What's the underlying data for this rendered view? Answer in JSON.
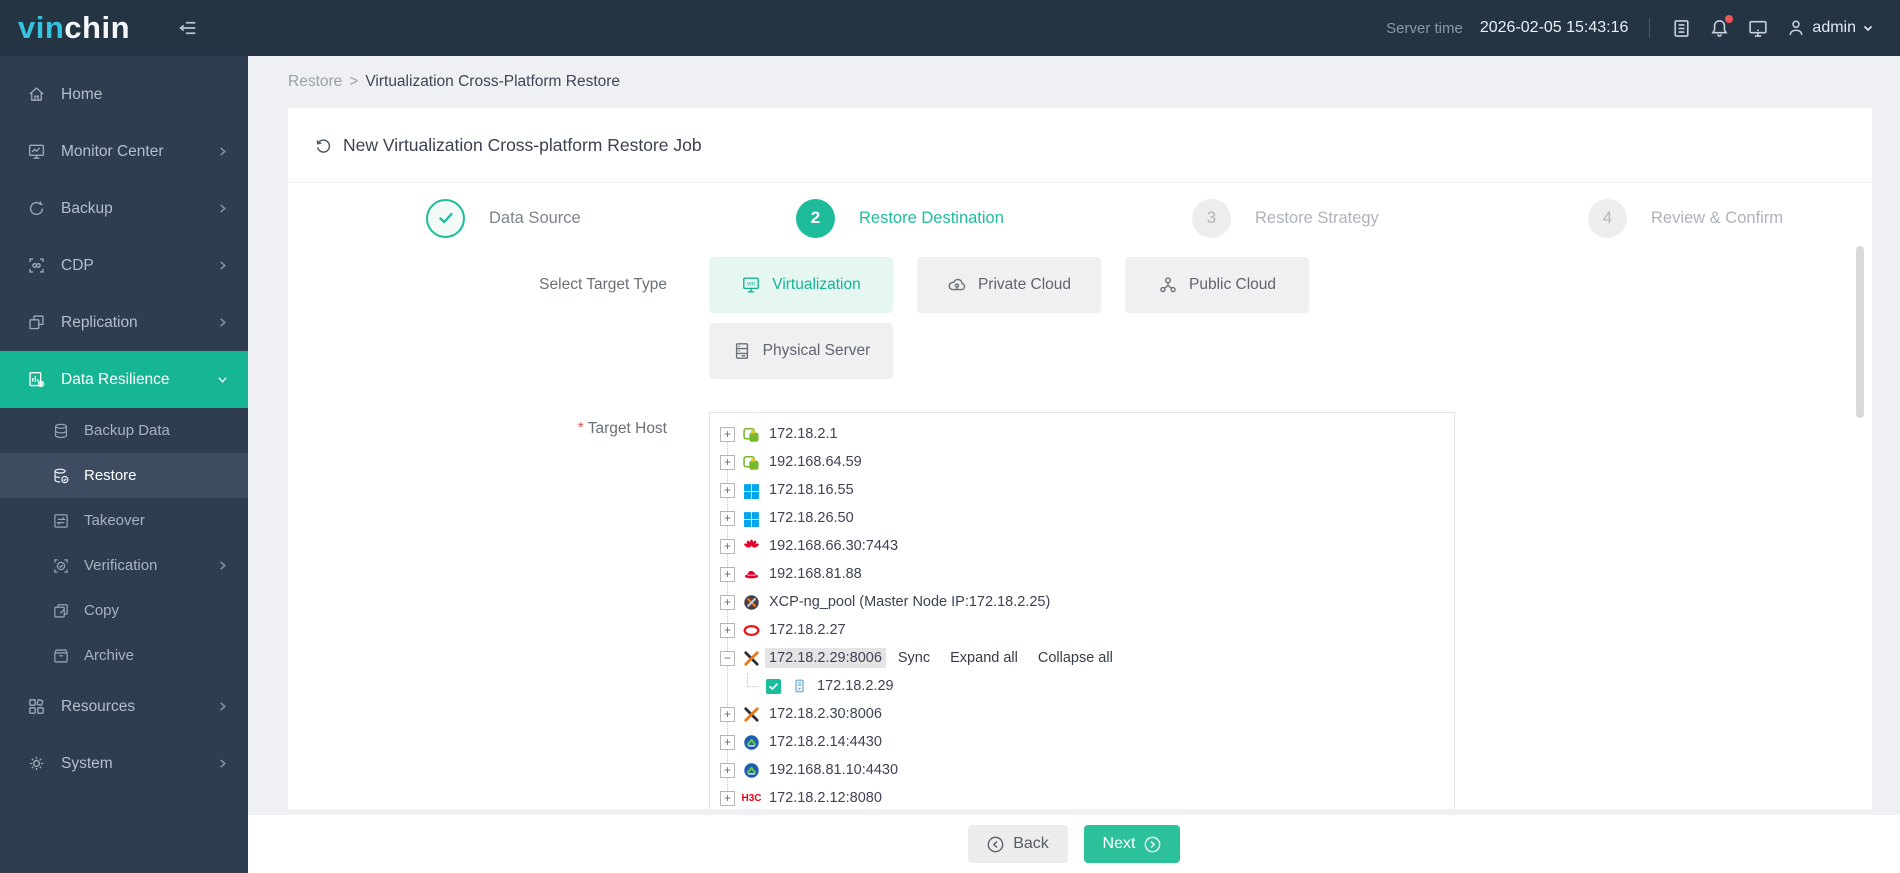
{
  "topbar": {
    "logo_part1": "vin",
    "logo_part2": "chin",
    "server_time_label": "Server time",
    "server_time_value": "2026-02-05 15:43:16",
    "user_name": "admin"
  },
  "sidebar": {
    "items": [
      {
        "label": "Home"
      },
      {
        "label": "Monitor Center"
      },
      {
        "label": "Backup"
      },
      {
        "label": "CDP"
      },
      {
        "label": "Replication"
      },
      {
        "label": "Data Resilience"
      },
      {
        "label": "Resources"
      },
      {
        "label": "System"
      }
    ],
    "submenu": [
      {
        "label": "Backup Data"
      },
      {
        "label": "Restore"
      },
      {
        "label": "Takeover"
      },
      {
        "label": "Verification"
      },
      {
        "label": "Copy"
      },
      {
        "label": "Archive"
      }
    ]
  },
  "breadcrumb": {
    "parent": "Restore",
    "separator": ">",
    "current": "Virtualization Cross-Platform Restore"
  },
  "card": {
    "title": "New Virtualization Cross-platform Restore Job"
  },
  "steps": [
    {
      "num": "",
      "label": "Data Source",
      "state": "done"
    },
    {
      "num": "2",
      "label": "Restore Destination",
      "state": "active"
    },
    {
      "num": "3",
      "label": "Restore Strategy",
      "state": "todo"
    },
    {
      "num": "4",
      "label": "Review & Confirm",
      "state": "todo"
    }
  ],
  "form": {
    "target_type_label": "Select Target Type",
    "types": [
      {
        "label": "Virtualization",
        "selected": true
      },
      {
        "label": "Private Cloud",
        "selected": false
      },
      {
        "label": "Public Cloud",
        "selected": false
      },
      {
        "label": "Physical Server",
        "selected": false
      }
    ],
    "required_mark": "*",
    "target_host_label": "Target Host"
  },
  "tree": {
    "rows": [
      {
        "icon": "ovirt",
        "expander": "+",
        "label": "172.18.2.1"
      },
      {
        "icon": "ovirt",
        "expander": "+",
        "label": "192.168.64.59"
      },
      {
        "icon": "hyperv",
        "expander": "+",
        "label": "172.18.16.55"
      },
      {
        "icon": "hyperv",
        "expander": "+",
        "label": "172.18.26.50"
      },
      {
        "icon": "huawei",
        "expander": "+",
        "label": "192.168.66.30:7443"
      },
      {
        "icon": "redhat",
        "expander": "+",
        "label": "192.168.81.88"
      },
      {
        "icon": "xcpng-pool",
        "expander": "+",
        "label": "XCP-ng_pool (Master Node IP:172.18.2.25)"
      },
      {
        "icon": "oracle",
        "expander": "+",
        "label": "172.18.2.27"
      },
      {
        "icon": "xcpng",
        "expander": "−",
        "label": "172.18.2.29:8006",
        "selected": true
      },
      {
        "icon": "host",
        "label": "172.18.2.29",
        "checked": true
      },
      {
        "icon": "xcpng",
        "expander": "+",
        "label": "172.18.2.30:8006"
      },
      {
        "icon": "zstack",
        "expander": "+",
        "label": "172.18.2.14:4430"
      },
      {
        "icon": "zstack",
        "expander": "+",
        "label": "192.168.81.10:4430"
      },
      {
        "icon": "h3c",
        "expander": "+",
        "label": "172.18.2.12:8080",
        "icon_text": "H3C"
      }
    ],
    "actions": [
      {
        "label": "Sync"
      },
      {
        "label": "Expand all"
      },
      {
        "label": "Collapse all"
      }
    ]
  },
  "footer": {
    "back_label": "Back",
    "next_label": "Next"
  },
  "colors": {
    "accent": "#1abc9c",
    "topbar_bg": "#243443",
    "sidebar_bg": "#2e3d4f",
    "next_button": "#2cc19b"
  }
}
